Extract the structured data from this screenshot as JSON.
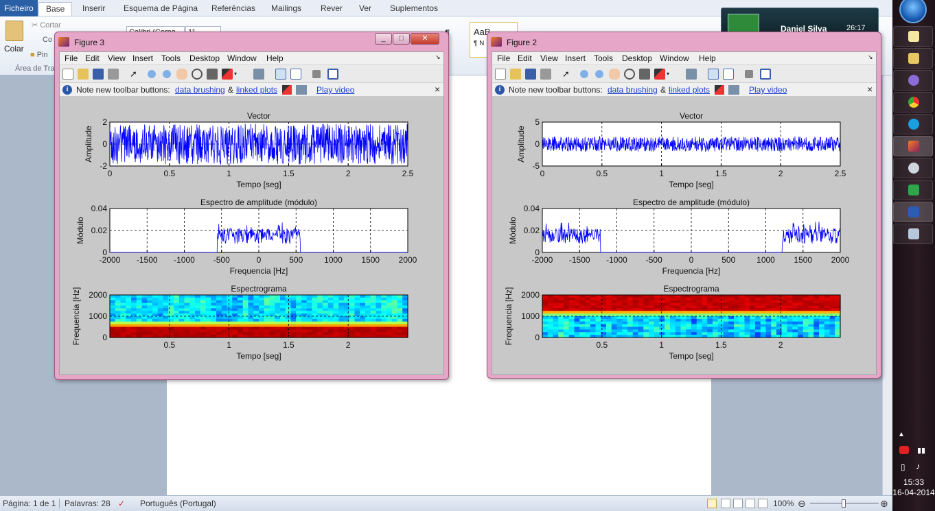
{
  "word": {
    "file_tab": "Ficheiro",
    "tabs": [
      "Base",
      "Inserir",
      "Esquema de Página",
      "Referências",
      "Mailings",
      "Rever",
      "Ver",
      "Suplementos"
    ],
    "clipboard": {
      "paste": "Colar",
      "cut": "Cortar",
      "copy": "Co",
      "painter": "Pin",
      "group": "Área de Tra"
    },
    "font_name": "Calibri (Corpo",
    "font_size": "11",
    "style_preview": "AaB",
    "style_label": "¶ N",
    "status": {
      "page": "Página: 1 de 1",
      "words": "Palavras: 28",
      "language": "Português (Portugal)",
      "zoom": "100%"
    }
  },
  "notification": {
    "name": "Daniel Silva",
    "time": "26:17"
  },
  "taskbar": {
    "time": "15:33",
    "date": "16-04-2014"
  },
  "common": {
    "menu": [
      "File",
      "Edit",
      "View",
      "Insert",
      "Tools",
      "Desktop",
      "Window",
      "Help"
    ],
    "info_text": "Note new toolbar buttons:",
    "link_brushing": "data brushing",
    "amp": "&",
    "link_linked": "linked plots",
    "link_video": "Play video",
    "close_x": "×"
  },
  "figures": [
    {
      "title": "Figure 3",
      "plots": [
        {
          "title": "Vector",
          "xlabel": "Tempo [seg]",
          "ylabel": "Amplitude",
          "xticks": [
            "0",
            "0.5",
            "1",
            "1.5",
            "2",
            "2.5"
          ],
          "yticks": [
            "2",
            "0",
            "-2"
          ]
        },
        {
          "title": "Espectro de amplitude (módulo)",
          "xlabel": "Frequencia [Hz]",
          "ylabel": "Módulo",
          "xticks": [
            "-2000",
            "-1500",
            "-1000",
            "-500",
            "0",
            "500",
            "1000",
            "1500",
            "2000"
          ],
          "yticks": [
            "0.04",
            "0.02",
            "0"
          ]
        },
        {
          "title": "Espectrograma",
          "xlabel": "Tempo [seg]",
          "ylabel": "Frequencia [Hz]",
          "xticks": [
            "0.5",
            "1",
            "1.5",
            "2"
          ],
          "yticks": [
            "2000",
            "1000",
            "0"
          ]
        }
      ]
    },
    {
      "title": "Figure 2",
      "plots": [
        {
          "title": "Vector",
          "xlabel": "Tempo [seg]",
          "ylabel": "Amplitude",
          "xticks": [
            "0",
            "0.5",
            "1",
            "1.5",
            "2",
            "2.5"
          ],
          "yticks": [
            "5",
            "0",
            "-5"
          ]
        },
        {
          "title": "Espectro de amplitude (módulo)",
          "xlabel": "Frequencia [Hz]",
          "ylabel": "Módulo",
          "xticks": [
            "-2000",
            "-1500",
            "-1000",
            "-500",
            "0",
            "500",
            "1000",
            "1500",
            "2000"
          ],
          "yticks": [
            "0.04",
            "0.02",
            "0"
          ]
        },
        {
          "title": "Espectrograma",
          "xlabel": "Tempo [seg]",
          "ylabel": "Frequencia [Hz]",
          "xticks": [
            "0.5",
            "1",
            "1.5",
            "2"
          ],
          "yticks": [
            "2000",
            "1000",
            "0"
          ]
        }
      ]
    }
  ]
}
